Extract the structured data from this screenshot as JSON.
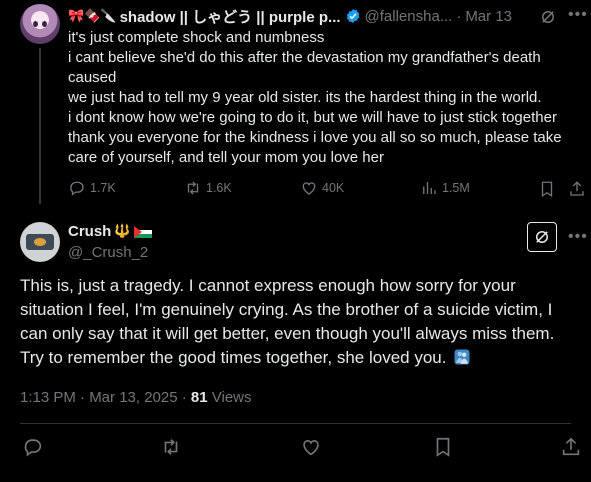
{
  "parent_post": {
    "emojis": "🎀🍫🔪",
    "display_name": "shadow || しゃどう || purple p...",
    "handle": "@fallensha...",
    "separator": "·",
    "date": "Mar 13",
    "lines": [
      "it's just complete shock and numbness",
      "i cant believe she'd do this after the devastation my grandfather's death caused",
      "we just had to tell my 9 year old sister. its the hardest thing in the world.",
      "i dont know how we're going to do it, but we will have to just stick together",
      "thank you everyone for the kindness i love you all so so much, please take care of yourself, and tell your mom you love her"
    ],
    "actions": {
      "replies": "1.7K",
      "reposts": "1.6K",
      "likes": "40K",
      "views": "1.5M"
    }
  },
  "reply_post": {
    "display_name": "Crush",
    "name_emoji": "🔱",
    "handle": "@_Crush_2",
    "text": "This is, just a tragedy. I cannot express enough how sorry for your situation I feel, I'm genuinely crying. As the brother of a suicide victim, I can only say that it will get better, even though you'll always miss them. Try to remember the good times together, she loved you.",
    "timestamp": "1:13 PM · Mar 13, 2025 · ",
    "views_count": "81",
    "views_label": " Views"
  },
  "colors": {
    "background": "#000000",
    "text": "#e7e9ea",
    "muted": "#71767b",
    "divider": "#2f3336",
    "verified": "#1d9bf0"
  },
  "icons": [
    "grok-icon",
    "more-icon",
    "reply-icon",
    "repost-icon",
    "like-icon",
    "views-icon",
    "bookmark-icon",
    "share-icon",
    "verified-badge-icon",
    "palestine-flag-icon",
    "hug-emoji-icon"
  ]
}
